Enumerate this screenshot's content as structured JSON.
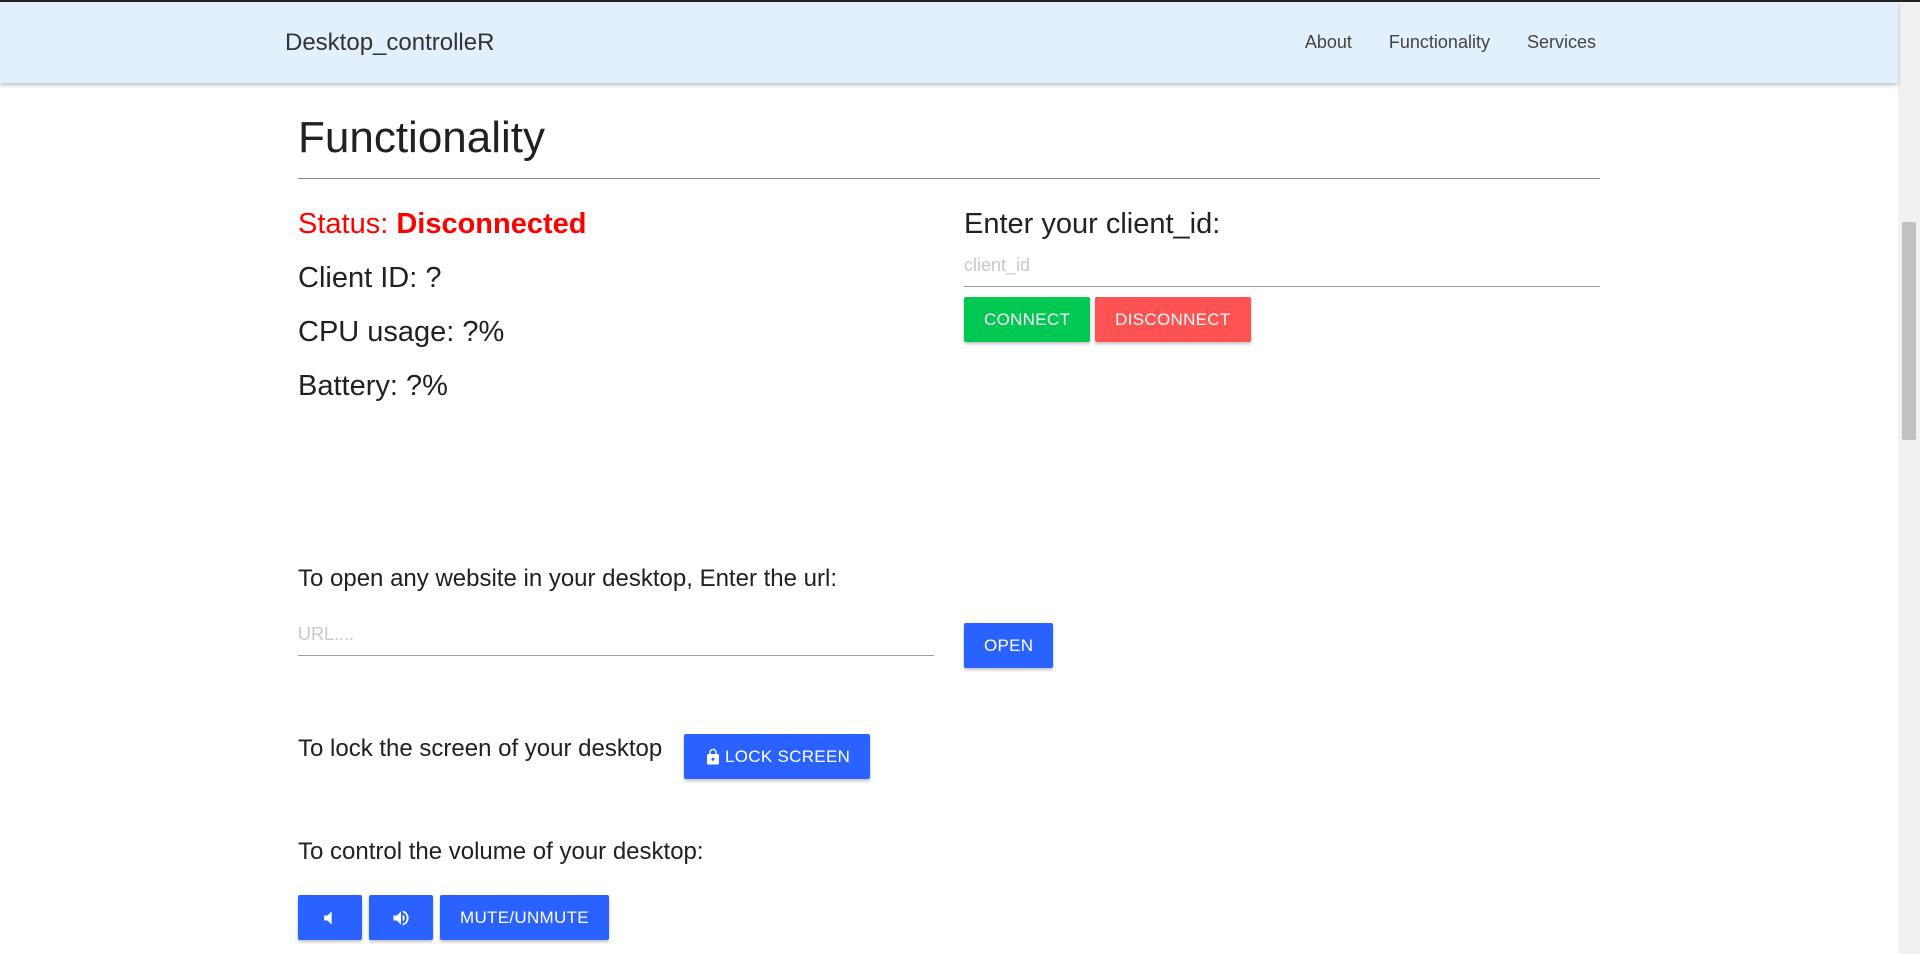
{
  "navbar": {
    "brand": "Desktop_controlleR",
    "links": [
      "About",
      "Functionality",
      "Services"
    ]
  },
  "section": {
    "title": "Functionality"
  },
  "status": {
    "label": "Status: ",
    "value": "Disconnected",
    "color": "#ff0000"
  },
  "info": {
    "client_id": "Client ID: ?",
    "cpu": "CPU usage: ?%",
    "battery": "Battery: ?%"
  },
  "connect_panel": {
    "label": "Enter your client_id:",
    "placeholder": "client_id",
    "connect_label": "CONNECT",
    "disconnect_label": "DISCONNECT"
  },
  "url_panel": {
    "label": "To open any website in your desktop, Enter the url:",
    "placeholder": "URL....",
    "open_label": "OPEN"
  },
  "lock_panel": {
    "label": "To lock the screen of your desktop",
    "button_label": "LOCK SCREEN"
  },
  "volume_panel": {
    "label": "To control the volume of your desktop:",
    "mute_label": "MUTE/UNMUTE"
  },
  "colors": {
    "navbar_bg": "#e1f0fb",
    "green": "#00c853",
    "red": "#ff5252",
    "blue": "#2962ff"
  }
}
